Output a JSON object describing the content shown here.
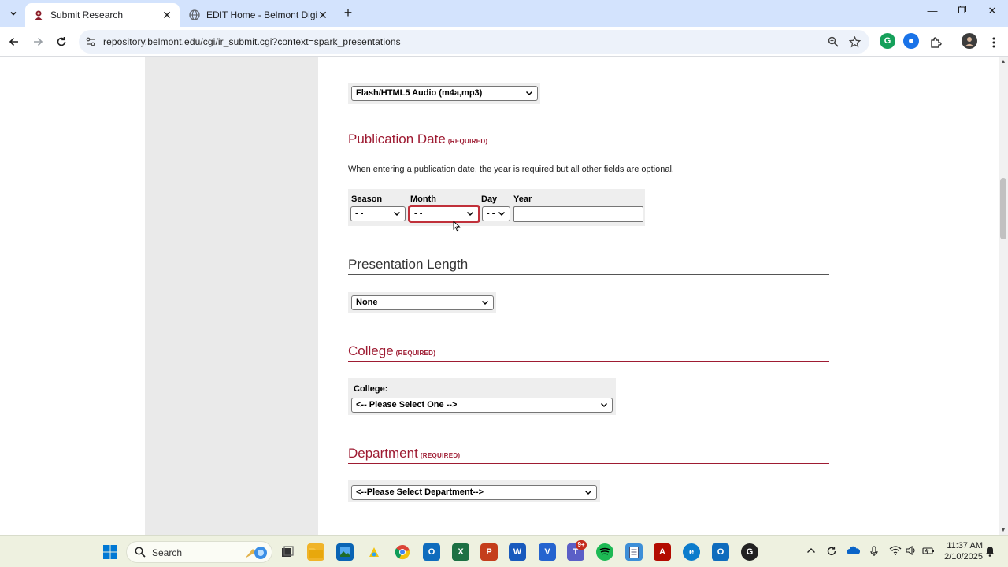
{
  "browser": {
    "tabs": [
      {
        "title": "Submit Research",
        "active": true
      },
      {
        "title": "EDIT Home - Belmont Digital Re",
        "active": false
      }
    ],
    "url": "repository.belmont.edu/cgi/ir_submit.cgi?context=spark_presentations"
  },
  "form": {
    "media_select": "Flash/HTML5 Audio (m4a,mp3)",
    "publication_date": {
      "title": "Publication Date",
      "required": "(REQUIRED)",
      "helper": "When entering a publication date, the year is required but all other fields are optional.",
      "season_label": "Season",
      "season_value": "- -",
      "month_label": "Month",
      "month_value": "- -",
      "day_label": "Day",
      "day_value": "- -",
      "year_label": "Year",
      "year_value": ""
    },
    "presentation_length": {
      "title": "Presentation Length",
      "value": "None"
    },
    "college": {
      "title": "College",
      "required": "(REQUIRED)",
      "label": "College:",
      "value": "<-- Please Select One -->"
    },
    "department": {
      "title": "Department",
      "required": "(REQUIRED)",
      "value": "<--Please Select Department-->"
    }
  },
  "taskbar": {
    "search_placeholder": "Search",
    "notification_badge": "9+",
    "time": "11:37 AM",
    "date": "2/10/2025"
  },
  "colors": {
    "accent_red": "#9e1b32",
    "tabbar": "#d3e3fd",
    "sidebar_gray": "#eaeaea"
  }
}
